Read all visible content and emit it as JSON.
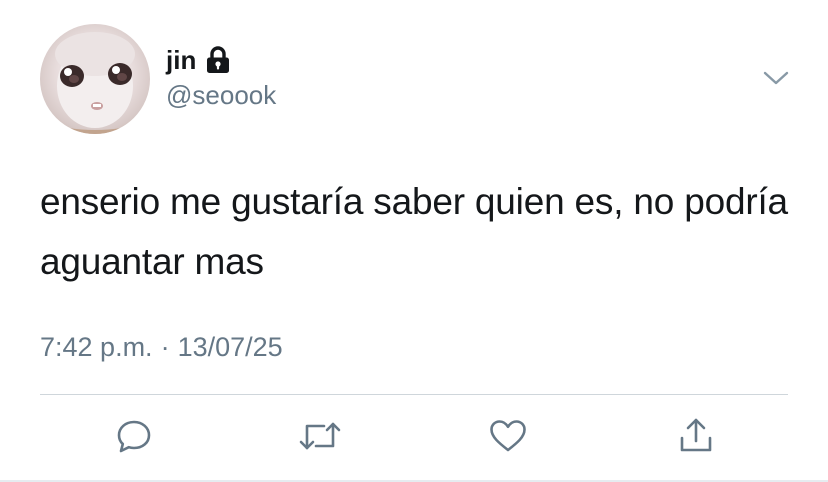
{
  "user": {
    "display_name": "jin",
    "handle": "@seoook",
    "protected_icon": "lock-icon",
    "avatar": "doll-face-avatar"
  },
  "tweet": {
    "text": "enserio me gustaría saber quien es, no podría aguantar mas",
    "time": "7:42 p.m.",
    "separator": "·",
    "date": "13/07/25"
  },
  "menu": {
    "icon": "chevron-down-icon"
  },
  "actions": [
    {
      "name": "reply",
      "icon": "reply-icon"
    },
    {
      "name": "retweet",
      "icon": "retweet-icon"
    },
    {
      "name": "like",
      "icon": "heart-icon"
    },
    {
      "name": "share",
      "icon": "share-icon"
    }
  ],
  "colors": {
    "text_primary": "#14171a",
    "text_secondary": "#657786",
    "icon": "#657786",
    "divider": "#cfd6db",
    "background": "#ffffff"
  }
}
